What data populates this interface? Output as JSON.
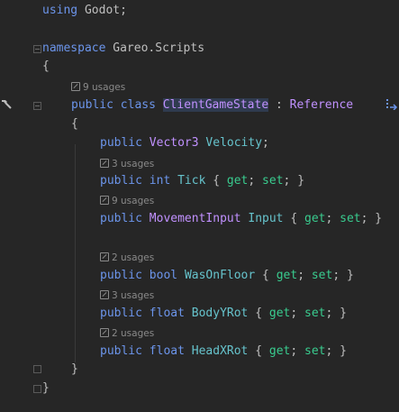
{
  "code": {
    "using_kw": "using",
    "using_ns": "Godot",
    "semicolon": ";",
    "namespace_kw": "namespace",
    "namespace_name": "Gareo.Scripts",
    "open_brace": "{",
    "close_brace": "}",
    "class_usages": "9 usages",
    "public_kw": "public",
    "class_kw": "class",
    "class_name": "ClientGameState",
    "colon": ":",
    "base_class": "Reference",
    "velocity_type": "Vector3",
    "velocity_name": "Velocity",
    "tick_usages": "3 usages",
    "int_kw": "int",
    "tick_name": "Tick",
    "get_kw": "get",
    "set_kw": "set",
    "input_usages": "9 usages",
    "input_type": "MovementInput",
    "input_name": "Input",
    "floor_usages": "2 usages",
    "bool_kw": "bool",
    "floor_name": "WasOnFloor",
    "body_usages": "3 usages",
    "float_kw": "float",
    "body_name": "BodyYRot",
    "head_usages": "2 usages",
    "head_name": "HeadXRot"
  },
  "icons": [
    "hammer-icon",
    "fold-icon",
    "inheritor-gutter-icon",
    "usages-icon"
  ],
  "colors": {
    "background": "#262626",
    "keyword": "#6c95eb",
    "type": "#c191ff",
    "member": "#66c3cc",
    "accessor": "#39cc8f",
    "hint": "#8a8a8a",
    "highlight": "#2f3b4f"
  }
}
